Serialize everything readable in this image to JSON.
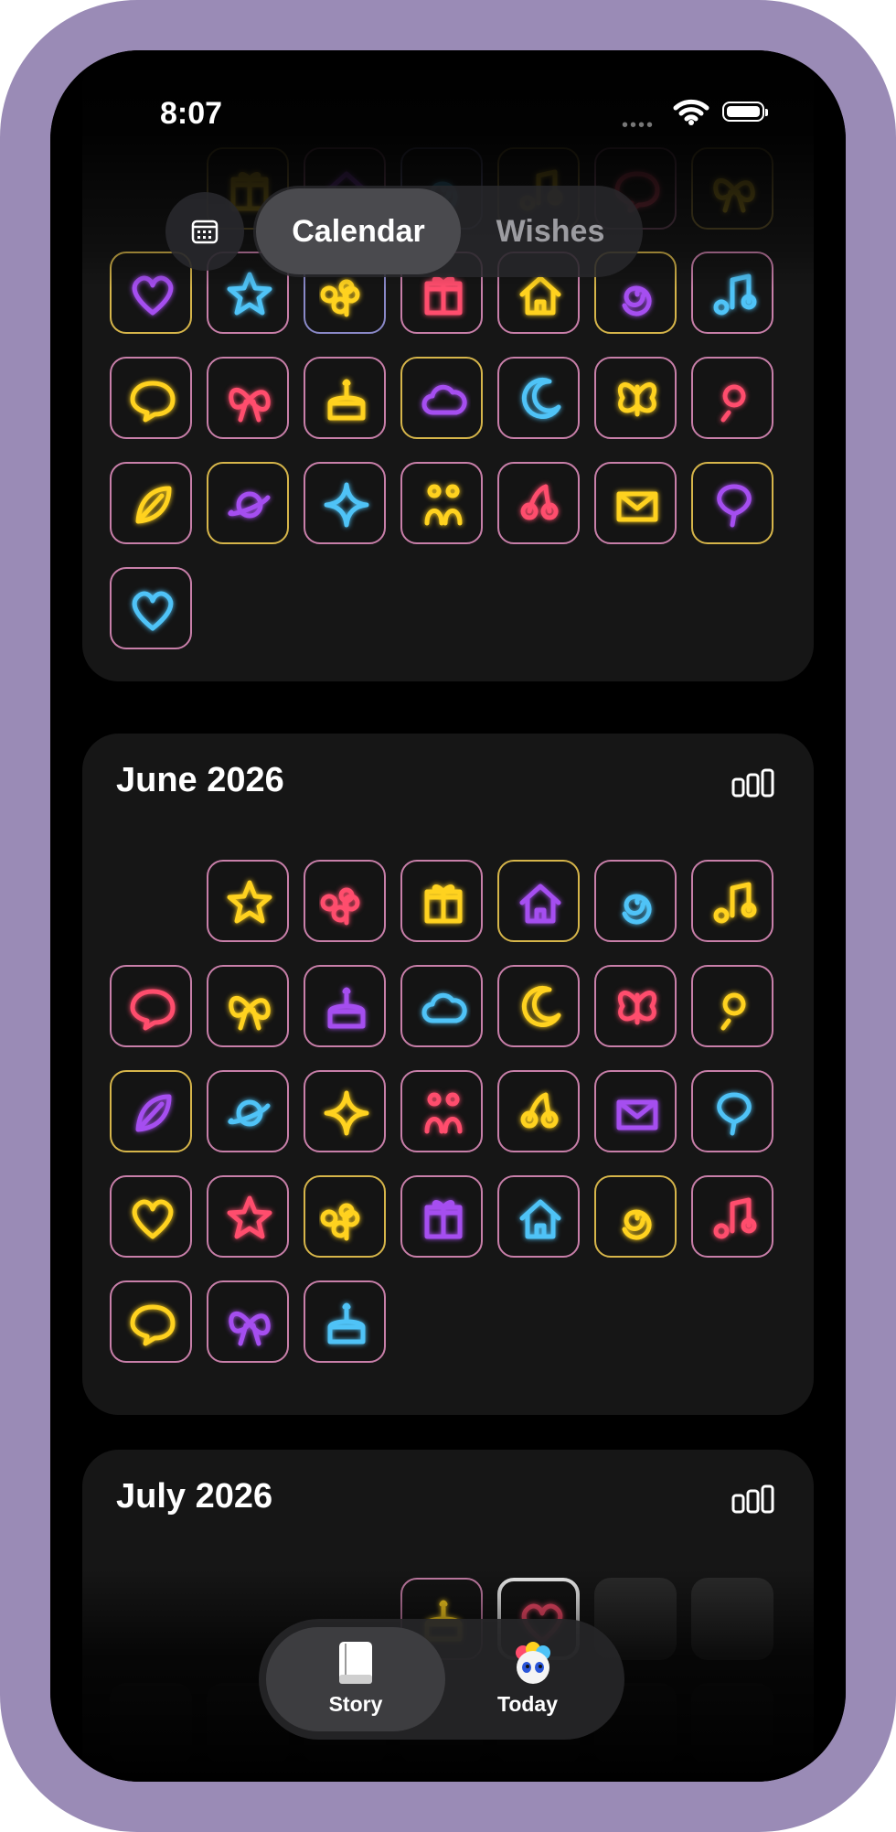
{
  "status_bar": {
    "time": "8:07"
  },
  "segmented": {
    "items": [
      "Calendar",
      "Wishes"
    ],
    "selected": "Calendar"
  },
  "months": [
    {
      "title": "June 2026"
    },
    {
      "title": "July 2026"
    }
  ],
  "tabbar": {
    "items": [
      {
        "label": "Story",
        "selected": true
      },
      {
        "label": "Today",
        "selected": false
      }
    ]
  },
  "colors": {
    "frame": "#9a8bb6",
    "pink": "#ff4d6d",
    "yellow": "#ffd21f",
    "blue": "#4fc3f7",
    "purple": "#a54ef0"
  }
}
